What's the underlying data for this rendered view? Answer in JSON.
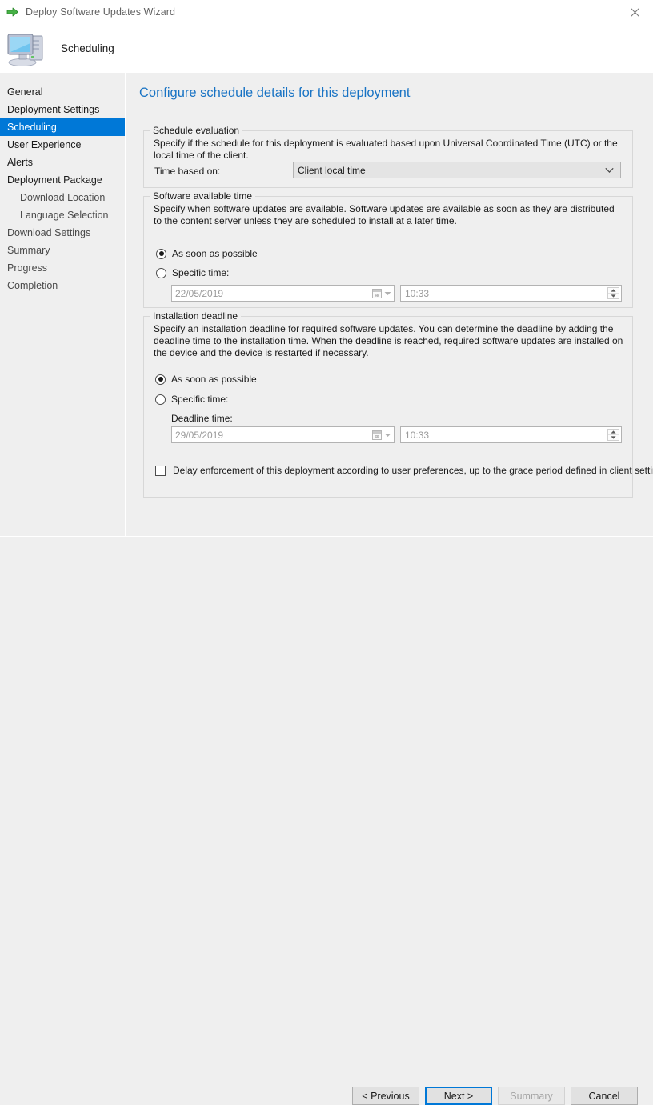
{
  "window": {
    "title": "Deploy Software Updates Wizard",
    "icon": "green-arrow-icon",
    "close_label": "✕"
  },
  "header": {
    "title": "Scheduling",
    "icon": "computer-icon"
  },
  "sidebar": {
    "items": [
      {
        "label": "General",
        "selected": false,
        "indent": false,
        "dim": false
      },
      {
        "label": "Deployment Settings",
        "selected": false,
        "indent": false,
        "dim": false
      },
      {
        "label": "Scheduling",
        "selected": true,
        "indent": false,
        "dim": false
      },
      {
        "label": "User Experience",
        "selected": false,
        "indent": false,
        "dim": false
      },
      {
        "label": "Alerts",
        "selected": false,
        "indent": false,
        "dim": false
      },
      {
        "label": "Deployment Package",
        "selected": false,
        "indent": false,
        "dim": false
      },
      {
        "label": "Download Location",
        "selected": false,
        "indent": true,
        "dim": true
      },
      {
        "label": "Language Selection",
        "selected": false,
        "indent": true,
        "dim": true
      },
      {
        "label": "Download Settings",
        "selected": false,
        "indent": false,
        "dim": true
      },
      {
        "label": "Summary",
        "selected": false,
        "indent": false,
        "dim": true
      },
      {
        "label": "Progress",
        "selected": false,
        "indent": false,
        "dim": true
      },
      {
        "label": "Completion",
        "selected": false,
        "indent": false,
        "dim": true
      }
    ]
  },
  "main": {
    "page_heading": "Configure schedule details for this deployment",
    "schedule_evaluation": {
      "legend": "Schedule evaluation",
      "description": "Specify if the schedule for this deployment is evaluated based upon Universal Coordinated Time (UTC) or the local time of the client.",
      "time_based_on_label": "Time based on:",
      "time_based_on_value": "Client local time"
    },
    "software_available_time": {
      "legend": "Software available time",
      "description": "Specify when software updates are available. Software updates are available as soon as they are distributed to the content server unless they are scheduled to install at a later time.",
      "asap_label": "As soon as possible",
      "asap_selected": true,
      "specific_label": "Specific time:",
      "specific_selected": false,
      "date_value": "22/05/2019",
      "time_value": "10:33"
    },
    "installation_deadline": {
      "legend": "Installation deadline",
      "description": "Specify an installation deadline for required software updates. You can determine the deadline by adding the deadline time to the installation time. When the deadline is reached, required software updates are installed on the device and the device is restarted if necessary.",
      "asap_label": "As soon as possible",
      "asap_selected": true,
      "specific_label": "Specific time:",
      "specific_selected": false,
      "deadline_time_label": "Deadline time:",
      "date_value": "29/05/2019",
      "time_value": "10:33",
      "delay_checkbox_label": "Delay enforcement of this deployment according to user preferences, up to the grace period defined in client settings.",
      "delay_checked": false
    }
  },
  "footer": {
    "previous_label": "< Previous",
    "next_label": "Next >",
    "summary_label": "Summary",
    "cancel_label": "Cancel"
  },
  "colors": {
    "accent": "#0078d7",
    "heading": "#1873c4",
    "background": "#efefef"
  }
}
